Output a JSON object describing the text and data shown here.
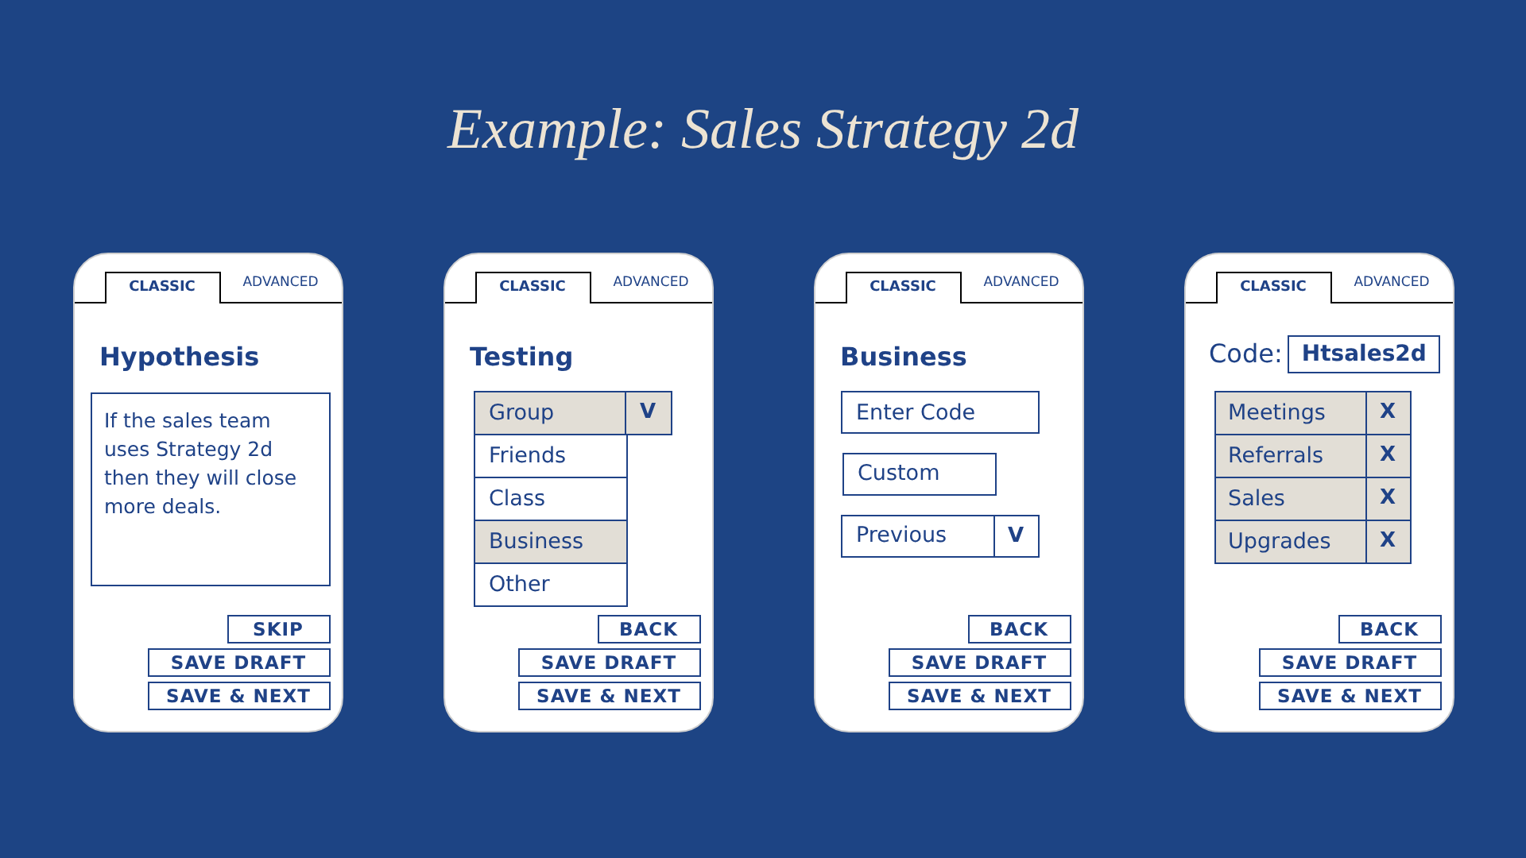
{
  "title": "Example: Sales Strategy 2d",
  "phones": [
    {
      "tabs": [
        {
          "label": "CLASSIC",
          "selected": true
        },
        {
          "label": "ADVANCED",
          "selected": false
        }
      ],
      "heading": "Hypothesis",
      "kind": "textarea",
      "text": "If the sales team uses Strategy 2d then they will close more deals.",
      "buttons": [
        {
          "label": "SKIP",
          "kind": "short"
        },
        {
          "label": "SAVE DRAFT",
          "kind": "wide"
        },
        {
          "label": "SAVE & NEXT",
          "kind": "wide"
        }
      ]
    },
    {
      "tabs": [
        {
          "label": "CLASSIC",
          "selected": true
        },
        {
          "label": "ADVANCED",
          "selected": false
        }
      ],
      "heading": "Testing",
      "kind": "dropdown",
      "value": "Group",
      "caret": "V",
      "options": [
        {
          "label": "Friends",
          "selected": false
        },
        {
          "label": "Class",
          "selected": false
        },
        {
          "label": "Business",
          "selected": true
        },
        {
          "label": "Other",
          "selected": false
        }
      ],
      "buttons": [
        {
          "label": "BACK",
          "kind": "short"
        },
        {
          "label": "SAVE DRAFT",
          "kind": "wide"
        },
        {
          "label": "SAVE & NEXT",
          "kind": "wide"
        }
      ]
    },
    {
      "tabs": [
        {
          "label": "CLASSIC",
          "selected": true
        },
        {
          "label": "ADVANCED",
          "selected": false
        }
      ],
      "heading": "Business",
      "kind": "choices",
      "items": [
        {
          "kind": "field",
          "placeholder": "Enter Code"
        },
        {
          "kind": "button",
          "label": "Custom"
        },
        {
          "kind": "select",
          "value": "Previous",
          "caret": "V"
        }
      ],
      "buttons": [
        {
          "label": "BACK",
          "kind": "short"
        },
        {
          "label": "SAVE DRAFT",
          "kind": "wide"
        },
        {
          "label": "SAVE & NEXT",
          "kind": "wide"
        }
      ]
    },
    {
      "tabs": [
        {
          "label": "CLASSIC",
          "selected": true
        },
        {
          "label": "ADVANCED",
          "selected": false
        }
      ],
      "kind": "code",
      "code_label": "Code:",
      "code_value": "Htsales2d",
      "tags": [
        {
          "label": "Meetings",
          "remove": "X"
        },
        {
          "label": "Referrals",
          "remove": "X"
        },
        {
          "label": "Sales",
          "remove": "X"
        },
        {
          "label": "Upgrades",
          "remove": "X"
        }
      ],
      "buttons": [
        {
          "label": "BACK",
          "kind": "short"
        },
        {
          "label": "SAVE DRAFT",
          "kind": "wide"
        },
        {
          "label": "SAVE & NEXT",
          "kind": "wide"
        }
      ]
    }
  ]
}
